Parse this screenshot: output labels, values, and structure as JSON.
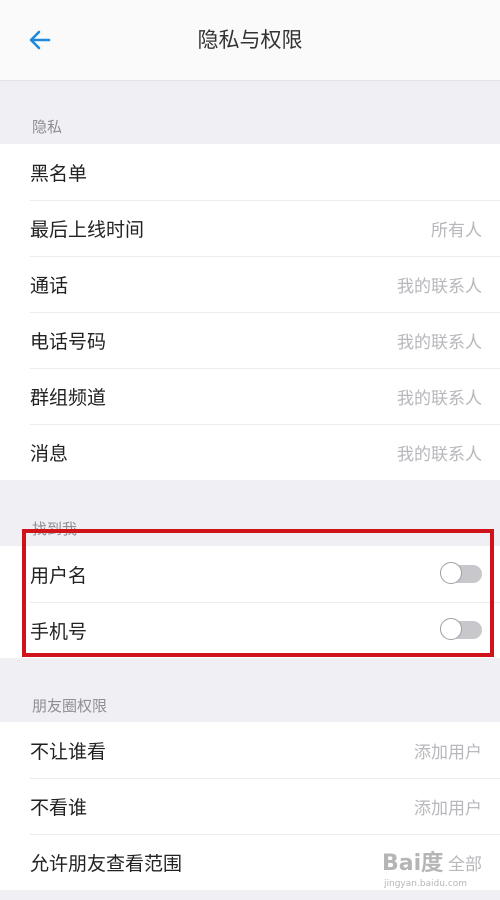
{
  "header": {
    "title": "隐私与权限",
    "back_icon": "arrow-left-icon",
    "accent_color": "#1d8ae0"
  },
  "privacy": {
    "header": "隐私",
    "items": [
      {
        "label": "黑名单",
        "value": ""
      },
      {
        "label": "最后上线时间",
        "value": "所有人"
      },
      {
        "label": "通话",
        "value": "我的联系人"
      },
      {
        "label": "电话号码",
        "value": "我的联系人"
      },
      {
        "label": "群组频道",
        "value": "我的联系人"
      },
      {
        "label": "消息",
        "value": "我的联系人"
      }
    ]
  },
  "find_me": {
    "header": "找到我",
    "items": [
      {
        "label": "用户名",
        "enabled": false
      },
      {
        "label": "手机号",
        "enabled": false
      }
    ]
  },
  "moments": {
    "header": "朋友圈权限",
    "items": [
      {
        "label": "不让谁看",
        "value": "添加用户"
      },
      {
        "label": "不看谁",
        "value": "添加用户"
      },
      {
        "label": "允许朋友查看范围",
        "value": "全部"
      }
    ]
  },
  "annotation": {
    "highlight_color": "#d0121b"
  },
  "watermark": {
    "brand": "Bai度",
    "url": "jingyan.baidu.com"
  }
}
